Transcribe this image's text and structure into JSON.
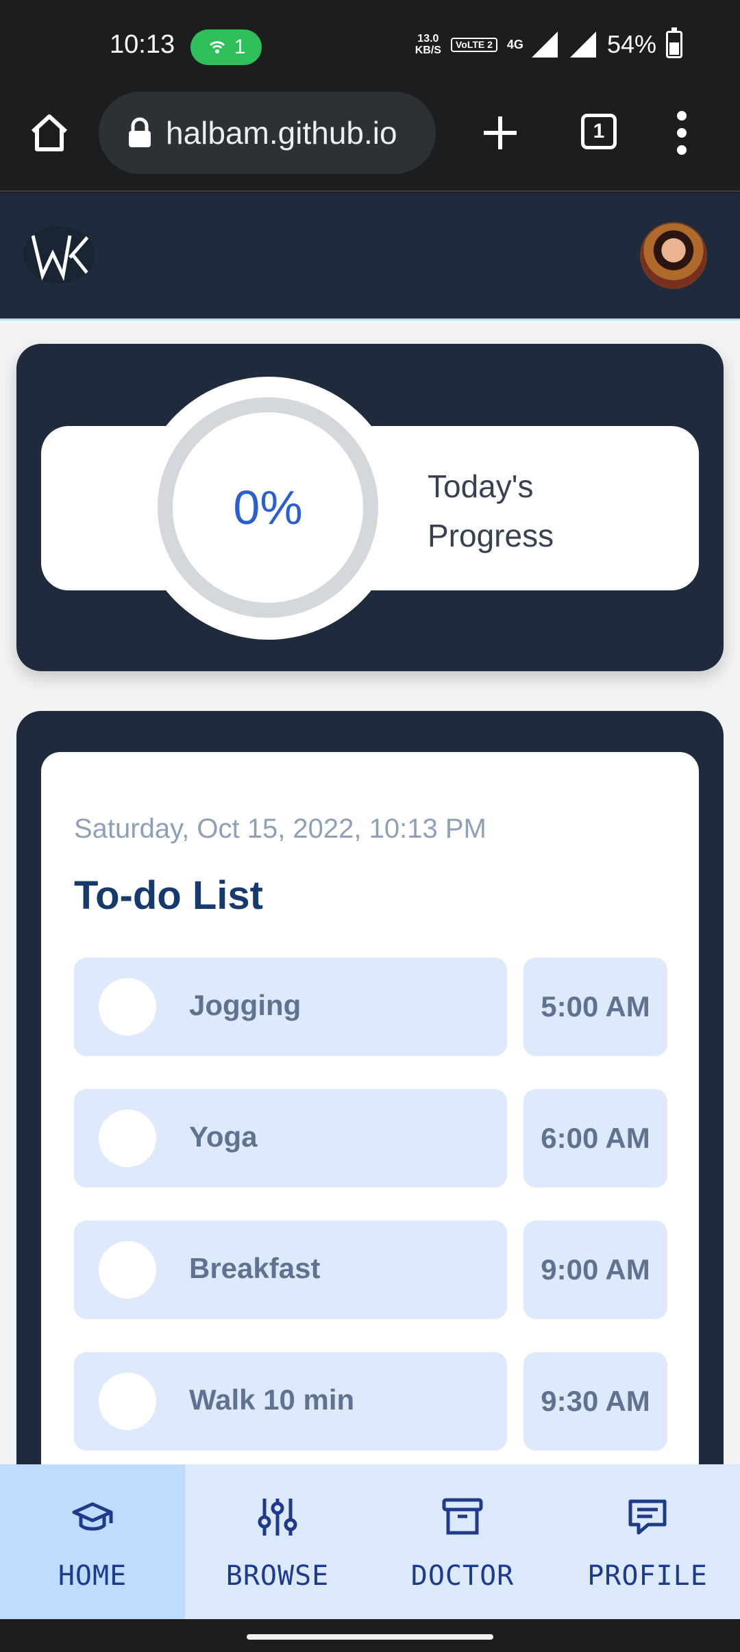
{
  "status_bar": {
    "time": "10:13",
    "hotspot_count": "1",
    "network_speed_value": "13.0",
    "network_speed_unit": "KB/S",
    "volte_label": "VoLTE 2",
    "network_type": "4G",
    "battery_percent": "54%"
  },
  "browser": {
    "url": "halbam.github.io",
    "tab_count": "1"
  },
  "progress": {
    "value": "0%",
    "label": "Today's Progress"
  },
  "todo": {
    "date": "Saturday, Oct 15, 2022, 10:13 PM",
    "title": "To-do List",
    "items": [
      {
        "task": "Jogging",
        "time": "5:00 AM"
      },
      {
        "task": "Yoga",
        "time": "6:00 AM"
      },
      {
        "task": "Breakfast",
        "time": "9:00 AM"
      },
      {
        "task": "Walk 10 min",
        "time": "9:30 AM"
      }
    ]
  },
  "nav": {
    "items": [
      {
        "label": "HOME",
        "icon": "graduation-cap-icon",
        "active": true
      },
      {
        "label": "BROWSE",
        "icon": "sliders-icon",
        "active": false
      },
      {
        "label": "DOCTOR",
        "icon": "archive-box-icon",
        "active": false
      },
      {
        "label": "PROFILE",
        "icon": "message-icon",
        "active": false
      }
    ]
  },
  "colors": {
    "header_bg": "#1f2a3c",
    "task_bg": "#dfe9fc",
    "progress_text": "#2a5fd0",
    "nav_active_bg": "#bfdbfe",
    "nav_bg": "#dce9fb"
  }
}
